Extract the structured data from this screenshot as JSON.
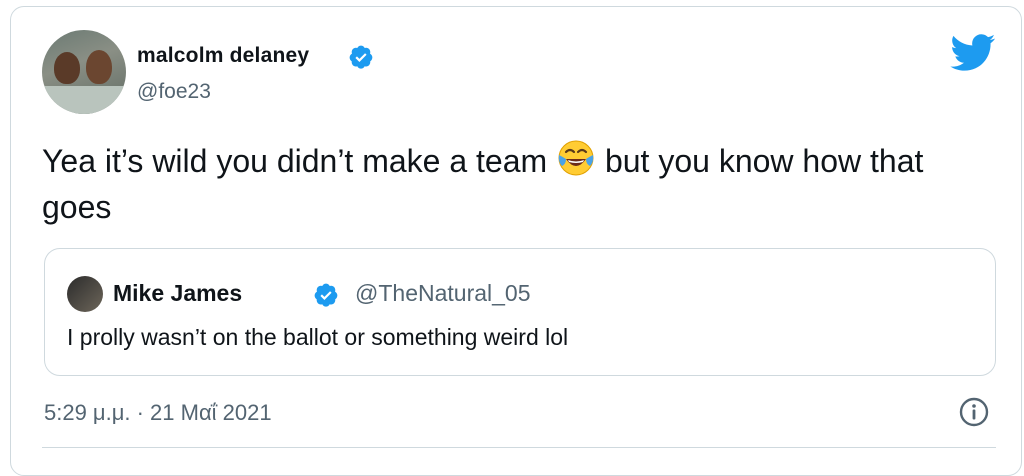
{
  "tweet": {
    "author": {
      "display_name": "malcolm delaney",
      "handle": "@foe23",
      "verified": true
    },
    "text_part1": "Yea it’s wild you didn’t make a team",
    "emoji": "face-with-tears-of-joy",
    "text_part2": " but you know how that goes",
    "timestamp": "5:29 μ.μ. · 21 Μαΐ 2021"
  },
  "quoted_tweet": {
    "display_name": "Mike James",
    "handle": "@TheNatural_05",
    "verified": true,
    "text": "I prolly wasn’t on the ballot or something weird lol"
  },
  "icons": {
    "brand": "twitter-bird-icon",
    "info": "info-icon",
    "verified": "verified-badge-icon"
  },
  "colors": {
    "twitter_blue": "#1d9bf0",
    "secondary_text": "#536471",
    "border": "#cfd9de"
  }
}
